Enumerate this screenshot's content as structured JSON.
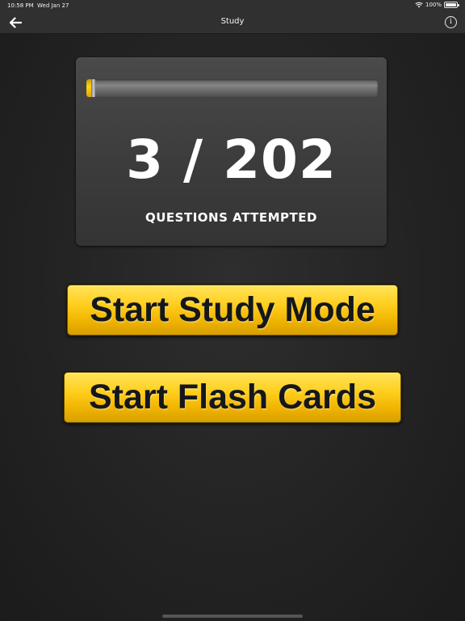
{
  "status_bar": {
    "time": "10:58 PM",
    "date": "Wed Jan 27",
    "battery": "100%"
  },
  "nav": {
    "title": "Study"
  },
  "progress": {
    "attempted": 3,
    "total": 202,
    "count_text": "3 / 202",
    "caption": "QUESTIONS ATTEMPTED"
  },
  "buttons": {
    "study_mode_label": "Start Study Mode",
    "flash_cards_label": "Start Flash Cards"
  },
  "colors": {
    "accent_yellow": "#ffcf1f",
    "button_text": "#14171c",
    "background": "#262626"
  },
  "icons": {
    "back": "back-arrow-icon",
    "info": "info-icon",
    "wifi": "wifi-icon",
    "battery": "battery-icon"
  }
}
